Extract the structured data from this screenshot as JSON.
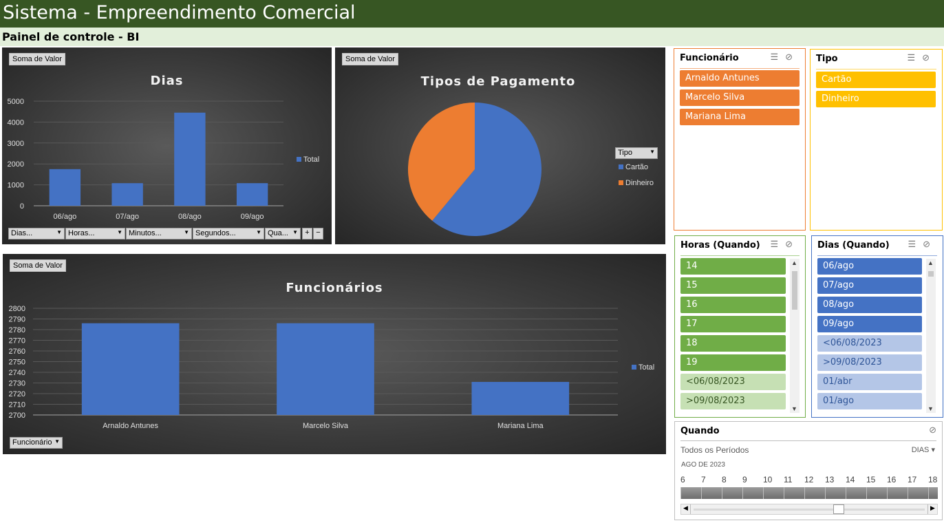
{
  "app": {
    "title": "Sistema - Empreendimento Comercial",
    "subtitle": "Painel de controle - BI"
  },
  "colors": {
    "header_green": "#375623",
    "subheader_green": "#e2efda",
    "bar_blue": "#4472c4",
    "pie_blue": "#4472c4",
    "pie_orange": "#ed7d31",
    "slicer_orange": "#ed7d31",
    "slicer_yellow": "#ffc000",
    "slicer_green": "#70ad47",
    "slicer_green_light": "#c6e0b4",
    "slicer_blue": "#4472c4",
    "slicer_blue_light": "#b4c6e7"
  },
  "dias_chart": {
    "field_button": "Soma de Valor",
    "filters": [
      "Dias...",
      "Horas...",
      "Minutos...",
      "Segundos...",
      "Qua..."
    ],
    "plus": "+",
    "minus": "−"
  },
  "pagamento_chart": {
    "field_button": "Soma de Valor",
    "legend_button": "Tipo"
  },
  "func_chart": {
    "field_button": "Soma de Valor",
    "axis_button": "Funcionário"
  },
  "chart_data": [
    {
      "type": "bar",
      "title": "Dias",
      "categories": [
        "06/ago",
        "07/ago",
        "08/ago",
        "09/ago"
      ],
      "series": [
        {
          "name": "Total",
          "values": [
            1750,
            1080,
            4450,
            1080
          ]
        }
      ],
      "ylim": [
        0,
        5000
      ],
      "yticks": [
        0,
        1000,
        2000,
        3000,
        4000,
        5000
      ],
      "legend": "right",
      "grid": true
    },
    {
      "type": "pie",
      "title": "Tipos de Pagamento",
      "categories": [
        "Cartão",
        "Dinheiro"
      ],
      "values": [
        61,
        39
      ],
      "legend": "right"
    },
    {
      "type": "bar",
      "title": "Funcionários",
      "categories": [
        "Arnaldo Antunes",
        "Marcelo Silva",
        "Mariana Lima"
      ],
      "series": [
        {
          "name": "Total",
          "values": [
            2786,
            2786,
            2731
          ]
        }
      ],
      "ylim": [
        2700,
        2800
      ],
      "yticks": [
        2700,
        2710,
        2720,
        2730,
        2740,
        2750,
        2760,
        2770,
        2780,
        2790,
        2800
      ],
      "legend": "right",
      "grid": true
    }
  ],
  "slicers": {
    "funcionario": {
      "title": "Funcionário",
      "items": [
        "Arnaldo Antunes",
        "Marcelo Silva",
        "Mariana Lima"
      ]
    },
    "tipo": {
      "title": "Tipo",
      "items": [
        "Cartão",
        "Dinheiro"
      ]
    },
    "horas": {
      "title": "Horas (Quando)",
      "items": [
        "14",
        "15",
        "16",
        "17",
        "18",
        "19"
      ],
      "dim_items": [
        "<06/08/2023",
        ">09/08/2023"
      ]
    },
    "dias": {
      "title": "Dias (Quando)",
      "items": [
        "06/ago",
        "07/ago",
        "08/ago",
        "09/ago"
      ],
      "dim_items": [
        "<06/08/2023",
        ">09/08/2023",
        "01/abr",
        "01/ago"
      ]
    }
  },
  "timeline": {
    "title": "Quando",
    "period_label": "Todos os Períodos",
    "level": "DIAS",
    "month_label": "AGO DE 2023",
    "days": [
      "6",
      "7",
      "8",
      "9",
      "10",
      "11",
      "12",
      "13",
      "14",
      "15",
      "16",
      "17",
      "18"
    ]
  }
}
